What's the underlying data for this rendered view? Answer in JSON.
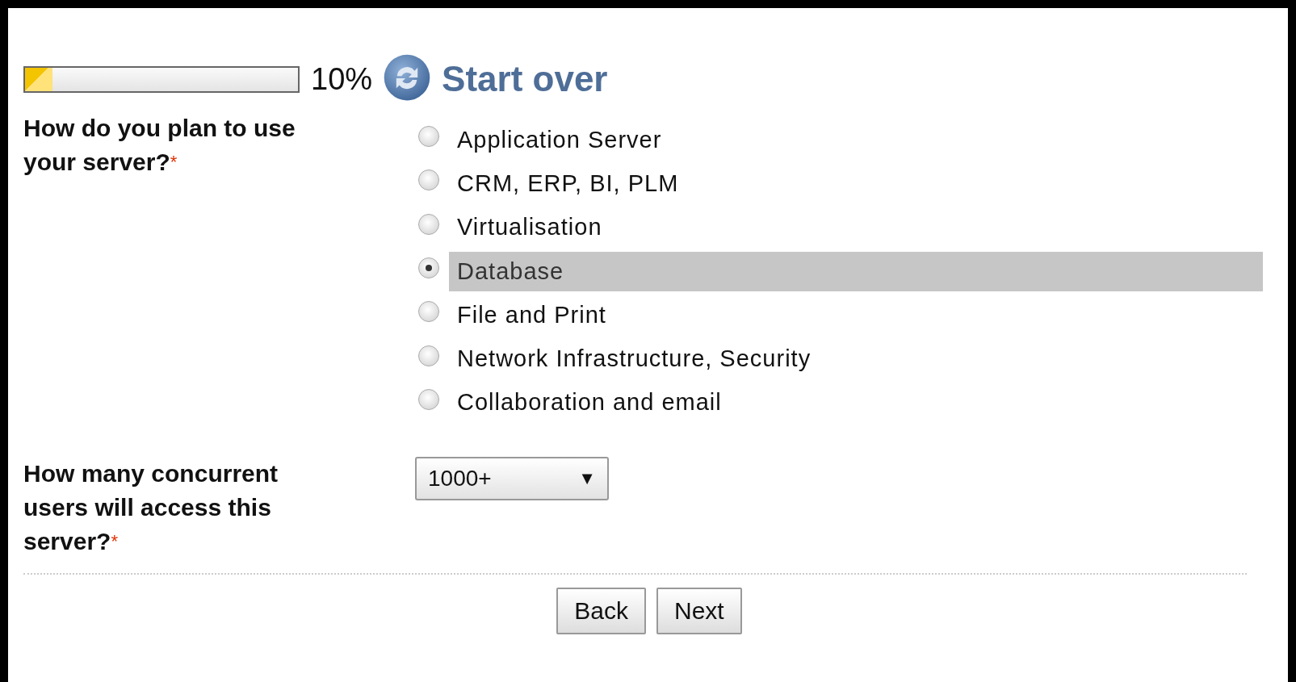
{
  "progress": {
    "level": 0.1,
    "reading": "10%"
  },
  "start_over": {
    "label": "Start over"
  },
  "questions": [
    {
      "kind": "radio",
      "label": "How do you plan to use your server?",
      "required_mark": "*",
      "options": [
        {
          "label": "Application Server",
          "selected": false
        },
        {
          "label": "CRM, ERP, BI, PLM",
          "selected": false
        },
        {
          "label": "Virtualisation",
          "selected": false
        },
        {
          "label": "Database",
          "selected": true
        },
        {
          "label": "File and Print",
          "selected": false
        },
        {
          "label": "Network Infrastructure, Security",
          "selected": false
        },
        {
          "label": "Collaboration and email",
          "selected": false
        }
      ]
    },
    {
      "kind": "select",
      "label": "How many concurrent users will access this server?",
      "required_mark": "*",
      "value": "1000+",
      "caret": "▼"
    }
  ],
  "buttons": [
    "Back",
    "Next"
  ]
}
